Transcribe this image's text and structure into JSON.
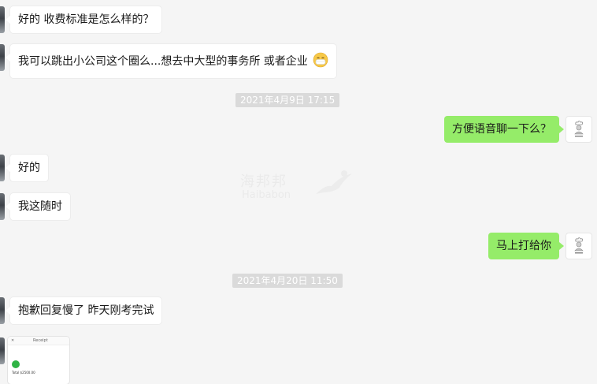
{
  "messages": [
    {
      "side": "left",
      "text": "好的 收费标准是怎么样的？"
    },
    {
      "side": "left",
      "text": "我可以跳出小公司这个圈么...想去中大型的事务所 或者企业",
      "emoji": "mask-face-emoji"
    },
    {
      "type": "timestamp",
      "text": "2021年4月9日 17:15"
    },
    {
      "side": "right",
      "text": "方便语音聊一下么？"
    },
    {
      "side": "left",
      "text": "好的"
    },
    {
      "side": "left",
      "text": "我这随时"
    },
    {
      "side": "right",
      "text": "马上打给你"
    },
    {
      "type": "timestamp",
      "text": "2021年4月20日 11:50"
    },
    {
      "side": "left",
      "text": "抱歉回复慢了 昨天刚考完试"
    }
  ],
  "thumbnail": {
    "close_glyph": "✕",
    "title": "Receipt",
    "amount_text": "Total $2500.00"
  },
  "watermark": {
    "brand_cn": "海邦邦",
    "brand_en": "Haibabon"
  },
  "colors": {
    "background": "#f5f5f5",
    "bubble_left": "#ffffff",
    "bubble_right": "#95ec69",
    "timestamp_bg": "#dadada"
  }
}
